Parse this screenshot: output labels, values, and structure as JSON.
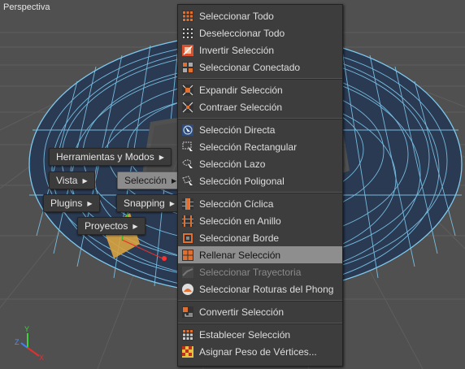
{
  "viewport": {
    "title": "Perspectiva"
  },
  "axes": {
    "y": "Y",
    "z": "Z",
    "x": "X"
  },
  "hud": {
    "herramientas": "Herramientas y Modos",
    "vista": "Vista",
    "seleccion": "Selección",
    "plugins": "Plugins",
    "snapping": "Snapping",
    "proyectos": "Proyectos"
  },
  "menu": {
    "items": [
      {
        "label": "Seleccionar Todo",
        "icon": "select-all-icon"
      },
      {
        "label": "Deseleccionar Todo",
        "icon": "deselect-all-icon"
      },
      {
        "label": "Invertir Selección",
        "icon": "invert-selection-icon"
      },
      {
        "label": "Seleccionar Conectado",
        "icon": "select-connected-icon"
      },
      {
        "label": "Expandir Selección",
        "icon": "grow-selection-icon"
      },
      {
        "label": "Contraer Selección",
        "icon": "shrink-selection-icon"
      },
      {
        "label": "Selección Directa",
        "icon": "live-selection-icon"
      },
      {
        "label": "Selección Rectangular",
        "icon": "rectangle-selection-icon"
      },
      {
        "label": "Selección Lazo",
        "icon": "lasso-selection-icon"
      },
      {
        "label": "Selección Poligonal",
        "icon": "polygon-selection-icon"
      },
      {
        "label": "Selección Cíclica",
        "icon": "loop-selection-icon"
      },
      {
        "label": "Selección en Anillo",
        "icon": "ring-selection-icon"
      },
      {
        "label": "Seleccionar Borde",
        "icon": "outline-selection-icon"
      },
      {
        "label": "Rellenar Selección",
        "icon": "fill-selection-icon"
      },
      {
        "label": "Seleccionar Trayectoria",
        "icon": "path-selection-icon"
      },
      {
        "label": "Seleccionar Roturas del Phong",
        "icon": "phong-break-selection-icon"
      },
      {
        "label": "Convertir Selección",
        "icon": "convert-selection-icon"
      },
      {
        "label": "Establecer Selección",
        "icon": "set-selection-icon"
      },
      {
        "label": "Asignar Peso de Vértices...",
        "icon": "vertex-weight-icon"
      }
    ]
  },
  "colors": {
    "wire": "#7ec8ee",
    "mesh": "#2a3a52",
    "menu_bg": "#3d3d3d",
    "highlight": "#8e8e8e",
    "accent_orange": "#d9a441"
  }
}
